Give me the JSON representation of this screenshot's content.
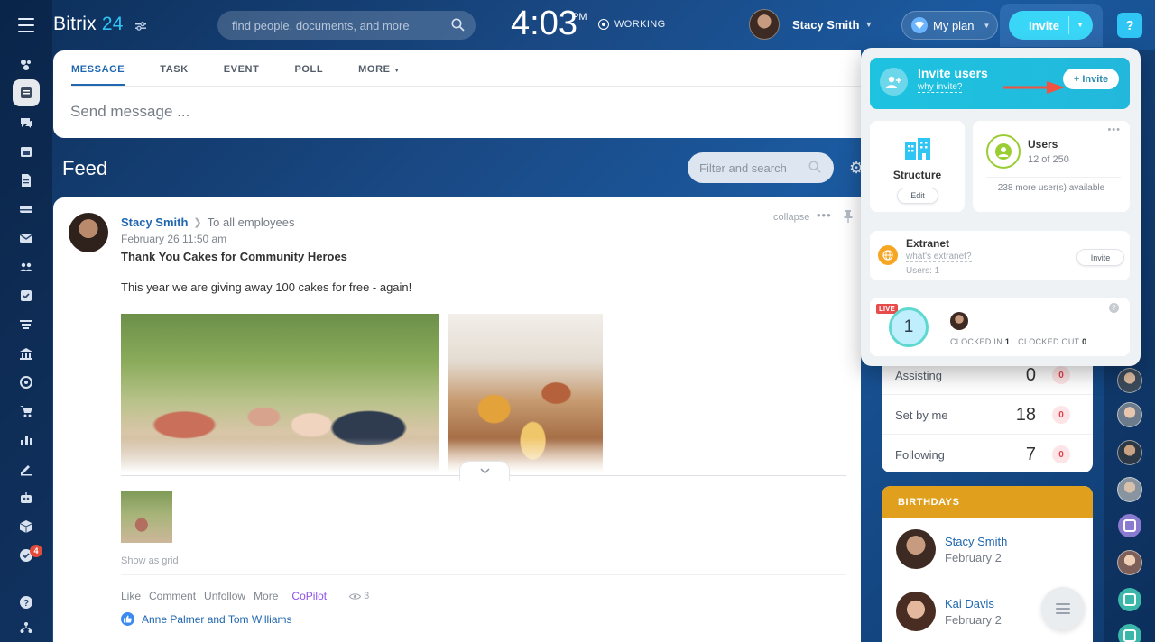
{
  "topbar": {
    "brand_name": "Bitrix",
    "brand_num": "24",
    "search_placeholder": "find people, documents, and more",
    "clock_time": "4:03",
    "clock_ampm": "PM",
    "status": "WORKING",
    "user_name": "Stacy Smith",
    "plan_label": "My plan",
    "invite_label": "Invite",
    "help_label": "?"
  },
  "sidebar": {
    "badge_count": "4",
    "icons": [
      "menu-icon",
      "activity-icon",
      "feed-icon",
      "chat-icon",
      "calendar-icon",
      "document-icon",
      "drive-icon",
      "mail-icon",
      "groups-icon",
      "tasks-icon",
      "filter-icon",
      "bank-icon",
      "target-icon",
      "cart-icon",
      "analytics-icon",
      "sign-icon",
      "robot-icon",
      "box-icon",
      "check-icon",
      "help-icon",
      "structure-icon"
    ]
  },
  "composer": {
    "tabs": [
      "MESSAGE",
      "TASK",
      "EVENT",
      "POLL",
      "MORE"
    ],
    "placeholder": "Send message ..."
  },
  "feed": {
    "title": "Feed",
    "filter_placeholder": "Filter and search"
  },
  "post": {
    "author": "Stacy Smith",
    "recipient": "To all employees",
    "date": "February 26 11:50 am",
    "title": "Thank You Cakes for Community Heroes",
    "body": "This year we are giving away 100 cakes for free - again!",
    "collapse": "collapse",
    "show_grid": "Show as grid",
    "actions": {
      "like": "Like",
      "comment": "Comment",
      "unfollow": "Unfollow",
      "more": "More",
      "copilot": "CoPilot",
      "views": "3"
    },
    "likes_text": "Anne Palmer and Tom Williams"
  },
  "tasks": {
    "rows": [
      {
        "label": "Assisting",
        "count": "0",
        "badge": "0"
      },
      {
        "label": "Set by me",
        "count": "18",
        "badge": "0"
      },
      {
        "label": "Following",
        "count": "7",
        "badge": "0"
      }
    ]
  },
  "birthdays": {
    "title": "BIRTHDAYS",
    "people": [
      {
        "name": "Stacy Smith",
        "date": "February 2"
      },
      {
        "name": "Kai Davis",
        "date": "February 2"
      }
    ]
  },
  "popup": {
    "invite_title": "Invite users",
    "invite_sub": "why invite?",
    "invite_btn": "Invite",
    "structure_label": "Structure",
    "structure_edit": "Edit",
    "users_title": "Users",
    "users_count": "12 of 250",
    "users_more": "238 more user(s) available",
    "extranet_title": "Extranet",
    "extranet_sub": "what's extranet?",
    "extranet_users": "Users: 1",
    "extranet_btn": "Invite",
    "live_label": "LIVE",
    "dial_value": "1",
    "clocked_in_label": "CLOCKED IN",
    "clocked_in_value": "1",
    "clocked_out_label": "CLOCKED OUT",
    "clocked_out_value": "0"
  },
  "colors": {
    "accent": "#2fc6f6",
    "link": "#2067b0",
    "birthday_header": "#e0a01e",
    "copilot": "#8e52ec"
  }
}
